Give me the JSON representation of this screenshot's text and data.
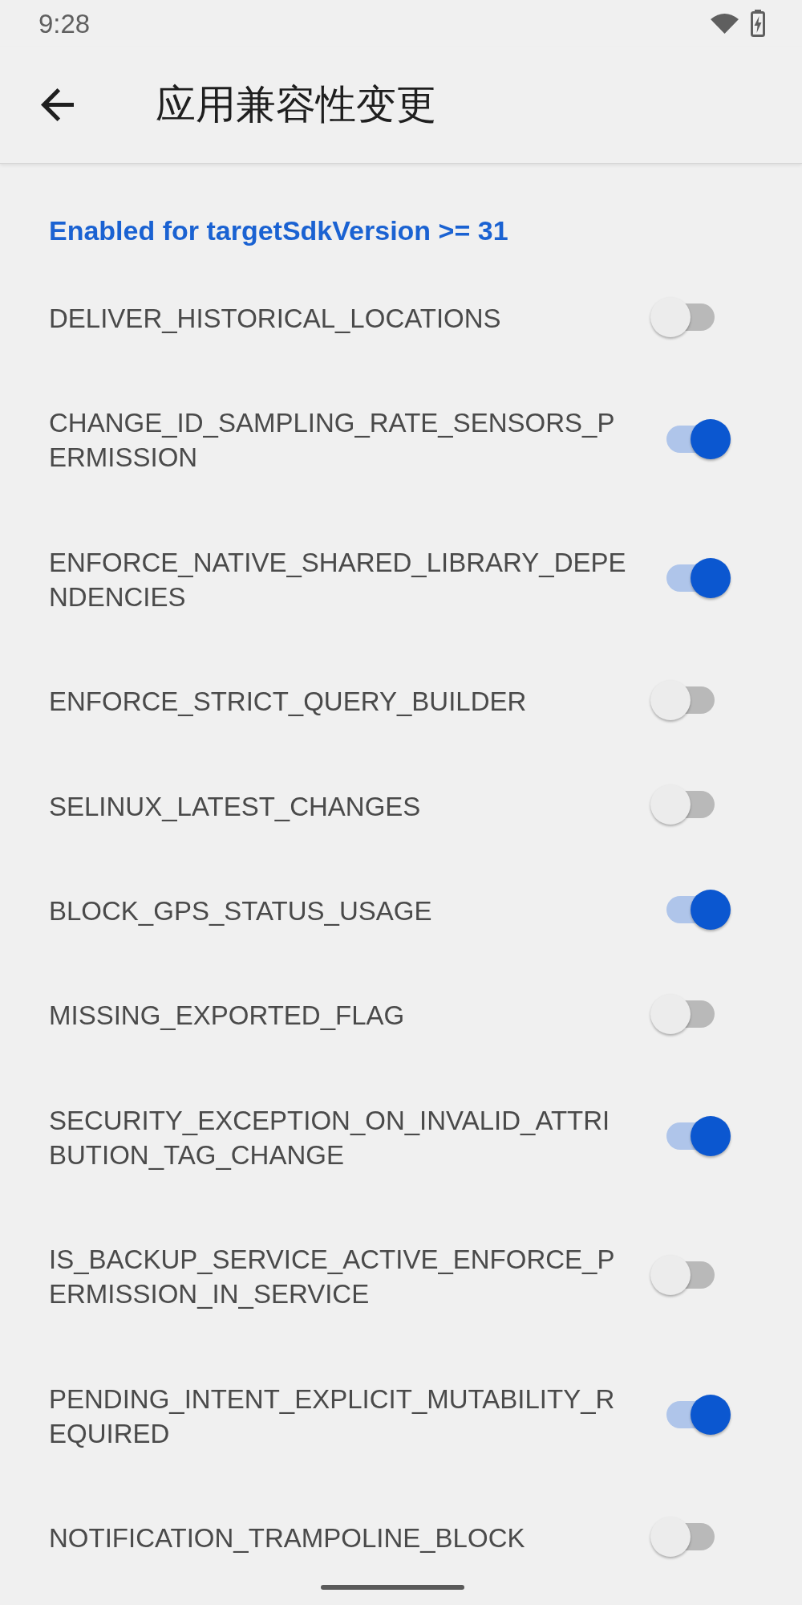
{
  "status_bar": {
    "time": "9:28"
  },
  "toolbar": {
    "title": "应用兼容性变更"
  },
  "section": {
    "header": "Enabled for targetSdkVersion >= 31"
  },
  "changes": [
    {
      "name": "DELIVER_HISTORICAL_LOCATIONS",
      "on": false
    },
    {
      "name": "CHANGE_ID_SAMPLING_RATE_SENSORS_PERMISSION",
      "on": true
    },
    {
      "name": "ENFORCE_NATIVE_SHARED_LIBRARY_DEPENDENCIES",
      "on": true
    },
    {
      "name": "ENFORCE_STRICT_QUERY_BUILDER",
      "on": false
    },
    {
      "name": "SELINUX_LATEST_CHANGES",
      "on": false
    },
    {
      "name": "BLOCK_GPS_STATUS_USAGE",
      "on": true
    },
    {
      "name": "MISSING_EXPORTED_FLAG",
      "on": false
    },
    {
      "name": "SECURITY_EXCEPTION_ON_INVALID_ATTRIBUTION_TAG_CHANGE",
      "on": true
    },
    {
      "name": "IS_BACKUP_SERVICE_ACTIVE_ENFORCE_PERMISSION_IN_SERVICE",
      "on": false
    },
    {
      "name": "PENDING_INTENT_EXPLICIT_MUTABILITY_REQUIRED",
      "on": true
    },
    {
      "name": "NOTIFICATION_TRAMPOLINE_BLOCK",
      "on": false
    }
  ]
}
